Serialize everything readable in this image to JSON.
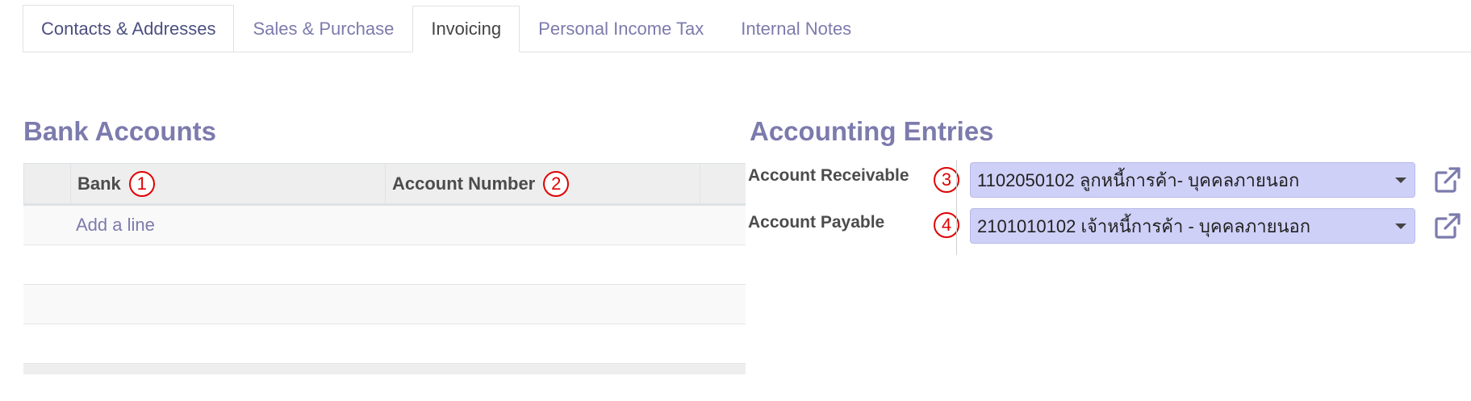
{
  "tabs": [
    {
      "label": "Contacts & Addresses"
    },
    {
      "label": "Sales & Purchase"
    },
    {
      "label": "Invoicing"
    },
    {
      "label": "Personal Income Tax"
    },
    {
      "label": "Internal Notes"
    }
  ],
  "bank_accounts": {
    "title": "Bank Accounts",
    "columns": {
      "bank": "Bank",
      "account_number": "Account Number"
    },
    "add_line": "Add a line"
  },
  "accounting_entries": {
    "title": "Accounting Entries",
    "receivable": {
      "label": "Account Receivable",
      "value": "1102050102 ลูกหนี้การค้า- บุคคลภายนอก"
    },
    "payable": {
      "label": "Account Payable",
      "value": "2101010102 เจ้าหนี้การค้า - บุคคลภายนอก"
    }
  },
  "annotations": {
    "one": "1",
    "two": "2",
    "three": "3",
    "four": "4"
  },
  "colors": {
    "accent": "#7c7bad",
    "field_bg": "#cfd0f8",
    "marker": "#e00000"
  },
  "icons": {
    "external_link": "external-link-icon",
    "dropdown": "caret-down-icon"
  }
}
